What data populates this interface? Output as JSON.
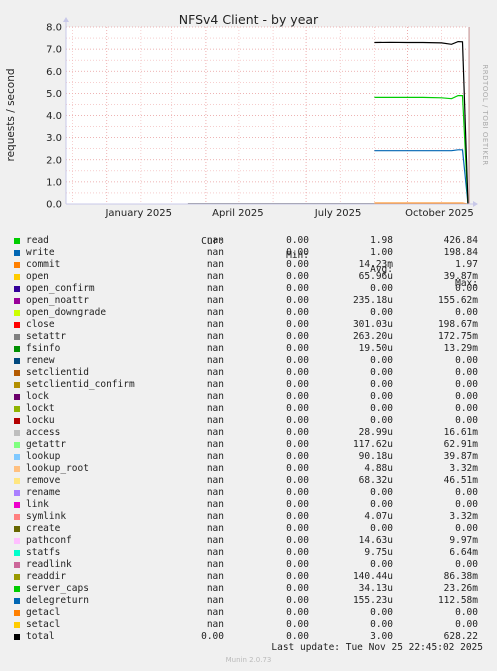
{
  "chart_data": {
    "type": "line",
    "title": "NFSv4 Client - by year",
    "ylabel": "requests / second",
    "ylim": [
      0,
      8.0
    ],
    "y_ticks": [
      "0.0",
      "1.0",
      "2.0",
      "3.0",
      "4.0",
      "5.0",
      "6.0",
      "7.0",
      "8.0"
    ],
    "x_ticks": [
      "January 2025",
      "April 2025",
      "July 2025",
      "October 2025"
    ],
    "grid": true,
    "side_label": "RRDTOOL / TOBI OETIKER",
    "series": [
      {
        "name": "total",
        "color": "#000000",
        "x": [
          "2025-09-01",
          "2025-09-15",
          "2025-10-01",
          "2025-10-15",
          "2025-11-01",
          "2025-11-10",
          "2025-11-16",
          "2025-11-20",
          "2025-11-25"
        ],
        "values": [
          7.3,
          7.31,
          7.3,
          7.3,
          7.28,
          7.22,
          7.34,
          7.33,
          0
        ]
      },
      {
        "name": "read",
        "color": "#00cc00",
        "x": [
          "2025-09-01",
          "2025-09-15",
          "2025-10-01",
          "2025-10-15",
          "2025-11-01",
          "2025-11-10",
          "2025-11-16",
          "2025-11-20",
          "2025-11-25"
        ],
        "values": [
          4.82,
          4.82,
          4.82,
          4.82,
          4.8,
          4.76,
          4.9,
          4.9,
          0
        ]
      },
      {
        "name": "write",
        "color": "#0066b3",
        "x": [
          "2025-09-01",
          "2025-09-15",
          "2025-10-01",
          "2025-10-15",
          "2025-11-01",
          "2025-11-10",
          "2025-11-16",
          "2025-11-20",
          "2025-11-25"
        ],
        "values": [
          2.41,
          2.41,
          2.41,
          2.41,
          2.41,
          2.41,
          2.45,
          2.45,
          0
        ]
      },
      {
        "name": "commit",
        "color": "#ff8000",
        "x": [
          "2025-09-01",
          "2025-10-01",
          "2025-11-01",
          "2025-11-20",
          "2025-11-25"
        ],
        "values": [
          0.04,
          0.04,
          0.04,
          0.04,
          0
        ]
      }
    ],
    "x_range": [
      "2024-11-25",
      "2025-11-25"
    ],
    "now_marker": "2025-11-26"
  },
  "legend": {
    "headers": {
      "cur": "Cur:",
      "min": "Min:",
      "avg": "Avg:",
      "max": "Max:"
    },
    "rows": [
      {
        "name": "read",
        "color": "#00cc00",
        "cur": "nan",
        "min": "0.00",
        "avg": "1.98",
        "max": "426.84"
      },
      {
        "name": "write",
        "color": "#0066b3",
        "cur": "nan",
        "min": "0.00",
        "avg": "1.00",
        "max": "198.84"
      },
      {
        "name": "commit",
        "color": "#ff8000",
        "cur": "nan",
        "min": "0.00",
        "avg": "14.23m",
        "max": "1.97"
      },
      {
        "name": "open",
        "color": "#ffcc00",
        "cur": "nan",
        "min": "0.00",
        "avg": "65.96u",
        "max": "39.87m"
      },
      {
        "name": "open_confirm",
        "color": "#330099",
        "cur": "nan",
        "min": "0.00",
        "avg": "0.00",
        "max": "0.00"
      },
      {
        "name": "open_noattr",
        "color": "#990099",
        "cur": "nan",
        "min": "0.00",
        "avg": "235.18u",
        "max": "155.62m"
      },
      {
        "name": "open_downgrade",
        "color": "#ccff00",
        "cur": "nan",
        "min": "0.00",
        "avg": "0.00",
        "max": "0.00"
      },
      {
        "name": "close",
        "color": "#ff0000",
        "cur": "nan",
        "min": "0.00",
        "avg": "301.03u",
        "max": "198.67m"
      },
      {
        "name": "setattr",
        "color": "#808080",
        "cur": "nan",
        "min": "0.00",
        "avg": "263.20u",
        "max": "172.75m"
      },
      {
        "name": "fsinfo",
        "color": "#008f00",
        "cur": "nan",
        "min": "0.00",
        "avg": "19.50u",
        "max": "13.29m"
      },
      {
        "name": "renew",
        "color": "#00487d",
        "cur": "nan",
        "min": "0.00",
        "avg": "0.00",
        "max": "0.00"
      },
      {
        "name": "setclientid",
        "color": "#b35a00",
        "cur": "nan",
        "min": "0.00",
        "avg": "0.00",
        "max": "0.00"
      },
      {
        "name": "setclientid_confirm",
        "color": "#b38f00",
        "cur": "nan",
        "min": "0.00",
        "avg": "0.00",
        "max": "0.00"
      },
      {
        "name": "lock",
        "color": "#6b006b",
        "cur": "nan",
        "min": "0.00",
        "avg": "0.00",
        "max": "0.00"
      },
      {
        "name": "lockt",
        "color": "#8fb300",
        "cur": "nan",
        "min": "0.00",
        "avg": "0.00",
        "max": "0.00"
      },
      {
        "name": "locku",
        "color": "#b30000",
        "cur": "nan",
        "min": "0.00",
        "avg": "0.00",
        "max": "0.00"
      },
      {
        "name": "access",
        "color": "#bebebe",
        "cur": "nan",
        "min": "0.00",
        "avg": "28.99u",
        "max": "16.61m"
      },
      {
        "name": "getattr",
        "color": "#80ff80",
        "cur": "nan",
        "min": "0.00",
        "avg": "117.62u",
        "max": "62.91m"
      },
      {
        "name": "lookup",
        "color": "#80c9ff",
        "cur": "nan",
        "min": "0.00",
        "avg": "90.18u",
        "max": "39.87m"
      },
      {
        "name": "lookup_root",
        "color": "#ffc080",
        "cur": "nan",
        "min": "0.00",
        "avg": "4.88u",
        "max": "3.32m"
      },
      {
        "name": "remove",
        "color": "#ffe680",
        "cur": "nan",
        "min": "0.00",
        "avg": "68.32u",
        "max": "46.51m"
      },
      {
        "name": "rename",
        "color": "#aa80ff",
        "cur": "nan",
        "min": "0.00",
        "avg": "0.00",
        "max": "0.00"
      },
      {
        "name": "link",
        "color": "#ee00cc",
        "cur": "nan",
        "min": "0.00",
        "avg": "0.00",
        "max": "0.00"
      },
      {
        "name": "symlink",
        "color": "#ff8080",
        "cur": "nan",
        "min": "0.00",
        "avg": "4.07u",
        "max": "3.32m"
      },
      {
        "name": "create",
        "color": "#666600",
        "cur": "nan",
        "min": "0.00",
        "avg": "0.00",
        "max": "0.00"
      },
      {
        "name": "pathconf",
        "color": "#ffbfff",
        "cur": "nan",
        "min": "0.00",
        "avg": "14.63u",
        "max": "9.97m"
      },
      {
        "name": "statfs",
        "color": "#00ffcc",
        "cur": "nan",
        "min": "0.00",
        "avg": "9.75u",
        "max": "6.64m"
      },
      {
        "name": "readlink",
        "color": "#cc6699",
        "cur": "nan",
        "min": "0.00",
        "avg": "0.00",
        "max": "0.00"
      },
      {
        "name": "readdir",
        "color": "#999900",
        "cur": "nan",
        "min": "0.00",
        "avg": "140.44u",
        "max": "86.38m"
      },
      {
        "name": "server_caps",
        "color": "#00cc00",
        "cur": "nan",
        "min": "0.00",
        "avg": "34.13u",
        "max": "23.26m"
      },
      {
        "name": "delegreturn",
        "color": "#0066b3",
        "cur": "nan",
        "min": "0.00",
        "avg": "155.23u",
        "max": "112.58m"
      },
      {
        "name": "getacl",
        "color": "#ff8000",
        "cur": "nan",
        "min": "0.00",
        "avg": "0.00",
        "max": "0.00"
      },
      {
        "name": "setacl",
        "color": "#ffcc00",
        "cur": "nan",
        "min": "0.00",
        "avg": "0.00",
        "max": "0.00"
      },
      {
        "name": "total",
        "color": "#000000",
        "cur": "0.00",
        "min": "0.00",
        "avg": "3.00",
        "max": "628.22"
      }
    ]
  },
  "footer": {
    "last_update": "Last update: Tue Nov 25 22:45:02 2025",
    "munin_version": "Munin 2.0.73"
  }
}
